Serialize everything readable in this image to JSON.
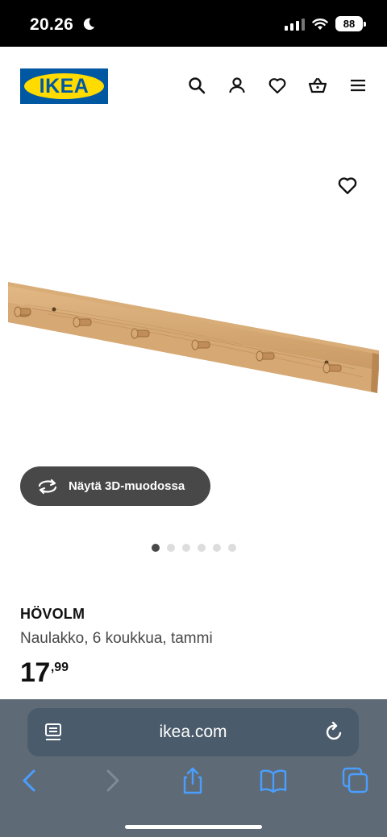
{
  "status_bar": {
    "time": "20.26",
    "battery": "88"
  },
  "header": {
    "logo_text": "IKEA",
    "icons": [
      "search-icon",
      "account-icon",
      "heart-icon",
      "basket-icon",
      "menu-icon"
    ]
  },
  "gallery": {
    "view_3d_label": "Näytä 3D-muodossa",
    "image_count": 6,
    "active_image": 1
  },
  "product": {
    "name": "HÖVOLM",
    "description": "Naulakko, 6 koukkua, tammi",
    "price_integer": "17",
    "price_decimal": ",99"
  },
  "browser": {
    "url": "ikea.com"
  },
  "colors": {
    "ikea_blue": "#0058a3",
    "ikea_yellow": "#ffdb00",
    "button_dark": "#484848",
    "safari_bar": "#5e6b76",
    "safari_accent": "#4a9eff"
  }
}
